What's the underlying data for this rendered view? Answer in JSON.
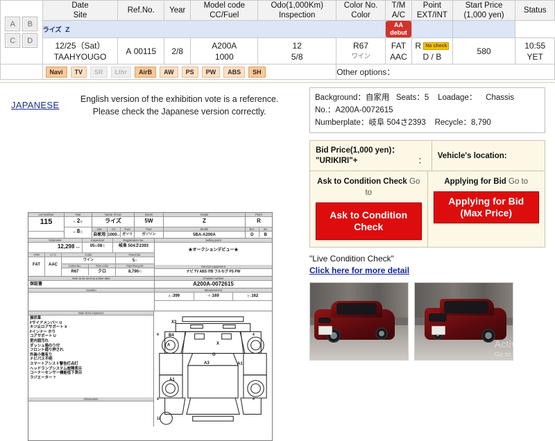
{
  "table": {
    "headers": [
      {
        "l1": "Date",
        "l2": "Site"
      },
      {
        "l1": "Ref.No.",
        "l2": ""
      },
      {
        "l1": "Year",
        "l2": ""
      },
      {
        "l1": "Model code",
        "l2": "CC/Fuel"
      },
      {
        "l1": "Odo(1,000Km)",
        "l2": "Inspection"
      },
      {
        "l1": "Color No.",
        "l2": "Color"
      },
      {
        "l1": "T/M",
        "l2": "A/C"
      },
      {
        "l1": "Point",
        "l2": "EXT/INT"
      },
      {
        "l1": "Start Price",
        "l2": "(1,000 yen)"
      },
      {
        "l1": "Status",
        "l2": ""
      }
    ],
    "corner_buttons": [
      "A",
      "B",
      "C",
      "D"
    ],
    "grade_row": {
      "kana": "ライズ",
      "grade": "Z",
      "badge": "AA debut"
    },
    "row": {
      "date": "12/25（Sat）",
      "site": "TAAHYOUGO",
      "ref_prefix": "A",
      "ref_no": "00115",
      "year": "2/8",
      "model_code": "A200A",
      "cc": "1000",
      "odo": "12",
      "inspection": "5/8",
      "color_no": "R67",
      "color_kana": "ワイン",
      "tm": "FAT",
      "ac": "AAC",
      "point": "R",
      "point_badge": "No check",
      "ext_int": "D / B",
      "start_price": "580",
      "status_time": "10:55",
      "status": "YET"
    },
    "options": [
      {
        "label": "Navi",
        "state": "strong"
      },
      {
        "label": "TV",
        "state": "on"
      },
      {
        "label": "SR",
        "state": "off"
      },
      {
        "label": "Lthr",
        "state": "off"
      },
      {
        "label": "AirB",
        "state": "strong"
      },
      {
        "label": "AW",
        "state": "on"
      },
      {
        "label": "PS",
        "state": "on"
      },
      {
        "label": "PW",
        "state": "on"
      },
      {
        "label": "ABS",
        "state": "on"
      },
      {
        "label": "SH",
        "state": "strong"
      }
    ],
    "other_options_label": "Other options："
  },
  "notice": {
    "japanese_link": "JAPANESE",
    "line1": "English version of the exhibition vote is a reference.",
    "line2": "Please check the Japanese version correctly."
  },
  "sheet": {
    "captions": {
      "lot_number": "Lot Number",
      "year": "Year",
      "name_of_car": "Name of Car",
      "doors": "Doors",
      "grade": "Grade",
      "point": "Point",
      "use": "Use",
      "cc": "CC",
      "fuel": "Fuel",
      "model": "Model",
      "ext": "Ext.",
      "int": "Int.",
      "odometer": "Odometer",
      "inspection": "Inspection",
      "registration": "Registration No.",
      "sh_tax": "Sh Aut-uni Chrgs",
      "color": "Color",
      "fixed_no": "Fixed No.",
      "rec_carry": "Rec. Carry",
      "color_no": "Color No.",
      "trim_color": "Trim color",
      "inspect_car": "Inspect car",
      "paid_recycle": "Paid Recycle",
      "item_later": "Item to be sent at a later date",
      "caution": "Caution",
      "notes": "Note from inspector",
      "selling_point": "Selling point",
      "service_equipment": "Service equipment",
      "chassis_number": "Chassis number",
      "measurement": "Measurement",
      "information": "Information"
    },
    "values": {
      "lot_number": "115",
      "year_era": "R",
      "year_num": "2",
      "year_month_era": "B",
      "year_month": "8",
      "name_of_car": "ライズ",
      "doors": "5W",
      "grade": "Z",
      "point": "R",
      "use": "自家用",
      "cc": "1000",
      "fuel": "ガソリン",
      "model": "5BA-A200A",
      "ext": "D",
      "int": "B",
      "odometer": "12,298",
      "odometer_unit": "km",
      "inspection": "05",
      "inspection_sep": "-",
      "inspection2": "08",
      "registration": "岐阜 504さ2393",
      "tm": "FAT",
      "ac": "AAC",
      "color": "ワイン",
      "color_no": "R67",
      "trim_color": "クロ",
      "fixed_no": "5",
      "rec_carry": "",
      "paid_recycle": "8,790",
      "item_later": "保証書",
      "selling_point": "★オークションデビュー★",
      "service_equipment": "ナビ  TV  ABS  ITB  フルセグ  PS  PW",
      "chassis_number": "A200A-0072615",
      "measure_a": "399",
      "measure_b": "169",
      "measure_c": "162",
      "inspector_notes": [
        "損状車",
        "Fサイドメンバー U",
        "キジ止ロアサポート X",
        "Fインナー かり",
        "コアサポート U",
        "室内弱汚れ",
        "ダッシュ箱のり付",
        "フロント廻り押され",
        "外装小傷有り",
        "ナビパス不明",
        "スマートアシスト警告灯点灯",
        "ヘッドランプシステム故障表示",
        "コーナーセンサー機能低下表示",
        "ラジエーター ?"
      ],
      "diagram_marks": [
        "X3",
        "B4",
        "A",
        "X",
        "G",
        "A3",
        "A1",
        "A1",
        "4",
        "4",
        "4",
        "4",
        "12"
      ]
    }
  },
  "info": {
    "background_label": "Background：",
    "background_value": "自家用",
    "seats_label": "Seats：",
    "seats_value": "5",
    "loadage_label": "Loadage：",
    "chassis_label": "Chassis",
    "chassis_no_label": "No.：",
    "chassis_no_value": "A200A-0072615",
    "numberplate_label": "Numberplate：",
    "numberplate_value": "岐阜 504さ2393",
    "recycle_label": "Recycle：",
    "recycle_value": "8,790"
  },
  "bid": {
    "bid_price_label": "Bid Price(1,000 yen)：",
    "urikiri_label": "\"URIKIRI\"+",
    "urikiri_colon": "：",
    "vehicle_location_label": "Vehicle's location:",
    "ask_goto_bold": "Ask to Condition Check",
    "ask_goto_sub": "Go to",
    "apply_goto_bold": "Applying for Bid",
    "apply_goto_sub": "Go to",
    "ask_button": "Ask to Condition Check",
    "apply_button_l1": "Applying for Bid",
    "apply_button_l2": "(Max Price)",
    "live_check_label": "\"Live Condition Check\"",
    "more_detail_link": "Click here for more detail"
  },
  "photos": [
    {
      "name": "front-three-quarter-photo"
    },
    {
      "name": "rear-three-quarter-photo"
    }
  ],
  "watermark": {
    "line1": "Activate Win",
    "line2": "Go to Settings"
  },
  "colors": {
    "accent_red": "#dd0d0d",
    "badge_red": "#d0342c",
    "grade_row_blue": "#dce6f6",
    "option_orange": "#f7c89a",
    "bid_panel_cream": "#fdf8e6",
    "link_blue": "#12249b",
    "car_body": "#5d0b0e"
  }
}
